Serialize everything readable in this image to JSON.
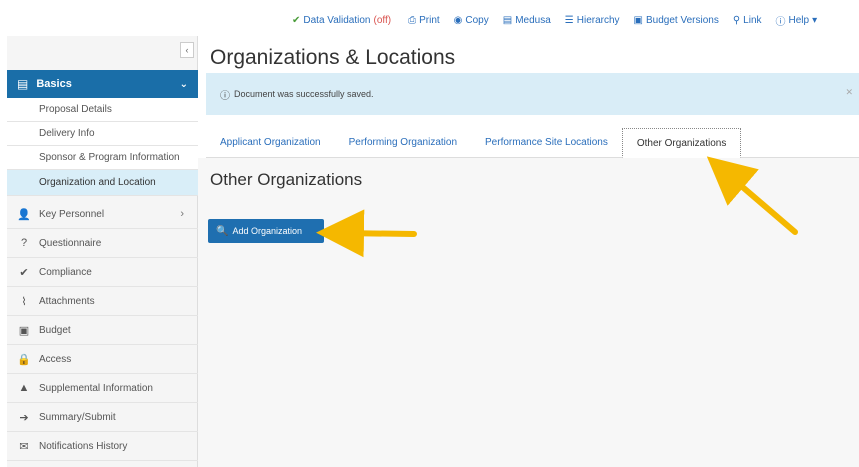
{
  "toolbar": {
    "data_validation": "Data Validation",
    "data_validation_state": "(off)",
    "print": "Print",
    "copy": "Copy",
    "medusa": "Medusa",
    "hierarchy": "Hierarchy",
    "budget_versions": "Budget Versions",
    "link": "Link",
    "help": "Help"
  },
  "sidebar": {
    "collapse": "‹",
    "basics_label": "Basics",
    "sub_items": [
      {
        "label": "Proposal Details"
      },
      {
        "label": "Delivery Info"
      },
      {
        "label": "Sponsor & Program Information"
      },
      {
        "label": "Organization and Location"
      }
    ],
    "nav_items": [
      {
        "label": "Key Personnel",
        "icon": "user-icon"
      },
      {
        "label": "Questionnaire",
        "icon": "question-icon"
      },
      {
        "label": "Compliance",
        "icon": "check-icon"
      },
      {
        "label": "Attachments",
        "icon": "paperclip-icon"
      },
      {
        "label": "Budget",
        "icon": "budget-icon"
      },
      {
        "label": "Access",
        "icon": "lock-icon"
      },
      {
        "label": "Supplemental Information",
        "icon": "supplemental-icon"
      },
      {
        "label": "Summary/Submit",
        "icon": "submit-icon"
      },
      {
        "label": "Notifications History",
        "icon": "envelope-icon"
      }
    ]
  },
  "main": {
    "page_title": "Organizations & Locations",
    "alert_text": "Document was successfully saved.",
    "tabs": [
      {
        "label": "Applicant Organization"
      },
      {
        "label": "Performing Organization"
      },
      {
        "label": "Performance Site Locations"
      },
      {
        "label": "Other Organizations"
      }
    ],
    "active_tab": "Other Organizations",
    "section_title": "Other Organizations",
    "add_button": "Add Organization"
  },
  "colors": {
    "accent": "#1a6ea8",
    "link": "#2a6ebb",
    "alert_bg": "#d9edf7",
    "annotation_arrow": "#f5b800"
  }
}
